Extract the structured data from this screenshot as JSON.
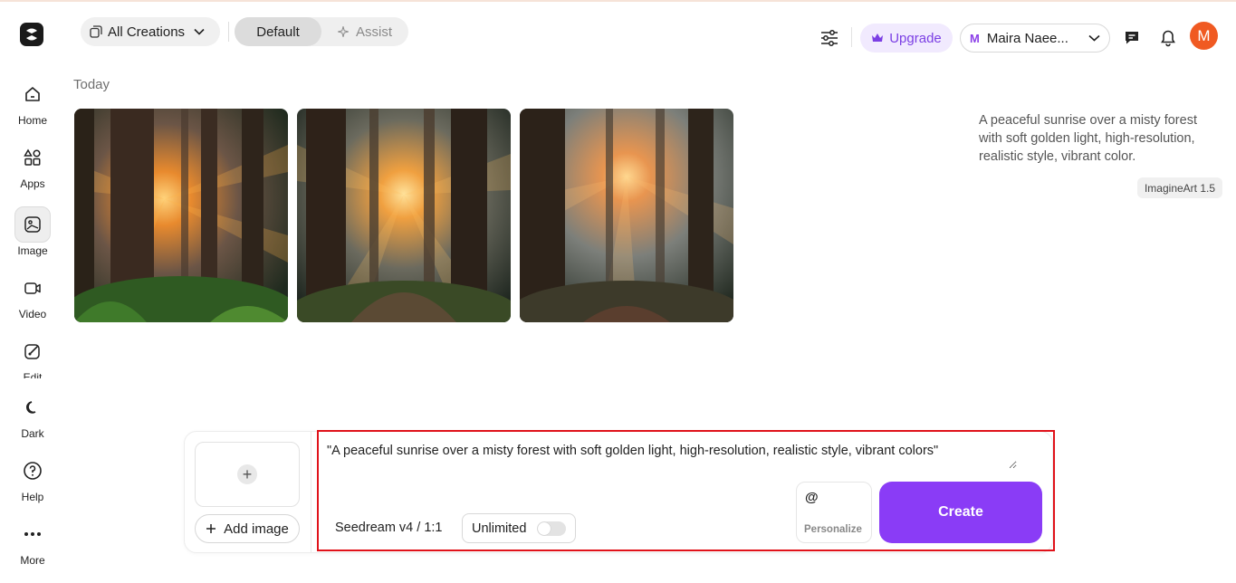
{
  "header": {
    "filter_label": "All Creations",
    "mode_tabs": [
      {
        "label": "Default",
        "active": true
      },
      {
        "label": "Assist",
        "active": false
      }
    ],
    "upgrade_label": "Upgrade",
    "account_initial": "M",
    "account_name": "Maira Naee...",
    "avatar_initial": "M"
  },
  "sidebar": {
    "items": [
      {
        "label": "Home",
        "icon": "home-icon"
      },
      {
        "label": "Apps",
        "icon": "apps-icon"
      },
      {
        "label": "Image",
        "icon": "image-icon",
        "active": true
      },
      {
        "label": "Video",
        "icon": "video-icon"
      },
      {
        "label": "Edit",
        "icon": "edit-icon"
      },
      {
        "label": "Dark",
        "icon": "moon-icon"
      },
      {
        "label": "Help",
        "icon": "help-icon"
      },
      {
        "label": "More",
        "icon": "more-icon"
      }
    ]
  },
  "gallery": {
    "section_title": "Today",
    "prompt": "A peaceful sunrise over a misty forest with soft golden light, high-resolution, realistic style, vibrant color.",
    "model_badge": "ImagineArt 1.5"
  },
  "composer": {
    "add_image_label": "Add image",
    "prompt_value": "\"A peaceful sunrise over a misty forest with soft golden light, high-resolution, realistic style, vibrant colors\"",
    "model_label": "Seedream v4 / 1:1",
    "unlimited_label": "Unlimited",
    "unlimited_on": false,
    "personalize_symbol": "@",
    "personalize_label": "Personalize",
    "create_label": "Create"
  },
  "colors": {
    "accent": "#8a3cf6",
    "upgrade_bg": "#f1eafe",
    "avatar_bg": "#f05a22",
    "highlight": "#e0121a"
  }
}
